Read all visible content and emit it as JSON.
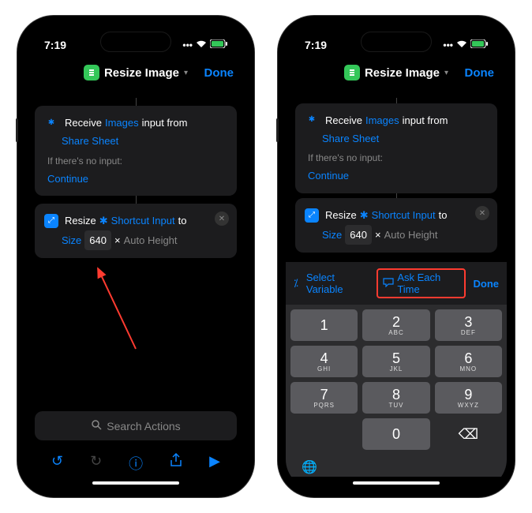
{
  "status": {
    "time": "7:19",
    "signal": "•••",
    "wifi": "wifi",
    "battery": "battery-charging"
  },
  "header": {
    "title": "Resize Image",
    "done": "Done"
  },
  "receive_card": {
    "receive": "Receive",
    "images": "Images",
    "input_from": "input from",
    "share_sheet": "Share Sheet",
    "no_input_label": "If there's no input:",
    "continue": "Continue"
  },
  "resize_card": {
    "resize": "Resize",
    "shortcut_input": "Shortcut Input",
    "to": "to",
    "size": "Size",
    "size_value": "640",
    "times": "×",
    "auto_height": "Auto Height"
  },
  "search": {
    "placeholder": "Search Actions"
  },
  "kbd_accessory": {
    "variable_icon": "variable-icon",
    "select_variable": "Select Variable",
    "ask_icon": "ask-icon",
    "ask_each_time": "Ask Each Time",
    "done": "Done"
  },
  "keypad": [
    {
      "num": "1",
      "sub": ""
    },
    {
      "num": "2",
      "sub": "ABC"
    },
    {
      "num": "3",
      "sub": "DEF"
    },
    {
      "num": "4",
      "sub": "GHI"
    },
    {
      "num": "5",
      "sub": "JKL"
    },
    {
      "num": "6",
      "sub": "MNO"
    },
    {
      "num": "7",
      "sub": "PQRS"
    },
    {
      "num": "8",
      "sub": "TUV"
    },
    {
      "num": "9",
      "sub": "WXYZ"
    },
    {
      "num": "",
      "sub": ""
    },
    {
      "num": "0",
      "sub": ""
    },
    {
      "num": "⌫",
      "sub": ""
    }
  ]
}
